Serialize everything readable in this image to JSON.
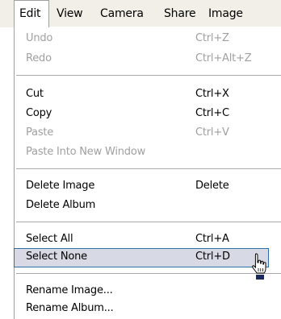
{
  "menubar": {
    "items": [
      "Edit",
      "View",
      "Camera",
      "Share",
      "Image"
    ],
    "active": "Edit"
  },
  "menu": {
    "undo": {
      "label": "Undo",
      "shortcut": "Ctrl+Z",
      "enabled": false
    },
    "redo": {
      "label": "Redo",
      "shortcut": "Ctrl+Alt+Z",
      "enabled": false
    },
    "cut": {
      "label": "Cut",
      "shortcut": "Ctrl+X",
      "enabled": true
    },
    "copy": {
      "label": "Copy",
      "shortcut": "Ctrl+C",
      "enabled": true
    },
    "paste": {
      "label": "Paste",
      "shortcut": "Ctrl+V",
      "enabled": false
    },
    "paste_new_window": {
      "label": "Paste Into New Window",
      "enabled": false
    },
    "delete_image": {
      "label": "Delete Image",
      "shortcut": "Delete",
      "enabled": true
    },
    "delete_album": {
      "label": "Delete Album",
      "enabled": true
    },
    "select_all": {
      "label": "Select All",
      "shortcut": "Ctrl+A",
      "enabled": true
    },
    "select_none": {
      "label": "Select None",
      "shortcut": "Ctrl+D",
      "enabled": true,
      "highlighted": true
    },
    "rename_image": {
      "label": "Rename Image...",
      "enabled": true
    },
    "rename_album": {
      "label": "Rename Album...",
      "enabled": true
    }
  },
  "colors": {
    "menubar_bg": "#f1efe7",
    "highlight_bg": "#d7d9e5",
    "highlight_border": "#2f6fa8",
    "disabled_text": "#a0a0a0"
  },
  "cursor_icon": "hand-pointer-icon"
}
